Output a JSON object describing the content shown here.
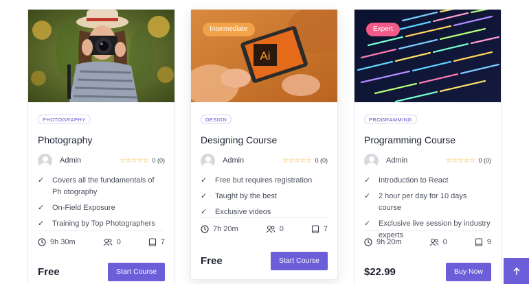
{
  "courses": [
    {
      "level": "",
      "category": "PHOTOGRAPHY",
      "title": "Photography",
      "author": "Admin",
      "rating_text": "0 (0)",
      "features": [
        "Covers all the fundamentals of Ph otography",
        "On-Field Exposure",
        "Training by Top Photographers"
      ],
      "duration": "9h 30m",
      "students": "0",
      "lessons": "7",
      "price": "Free",
      "button": "Start Course"
    },
    {
      "level": "Intermediate",
      "category": "DESIGN",
      "title": "Designing Course",
      "author": "Admin",
      "rating_text": "0 (0)",
      "features": [
        "Free but requires registration",
        "Taught by the best",
        "Exclusive videos"
      ],
      "duration": "7h 20m",
      "students": "0",
      "lessons": "7",
      "price": "Free",
      "button": "Start Course",
      "thumb_logo": "Ai"
    },
    {
      "level": "Expert",
      "category": "PROGRAMMING",
      "title": "Programming Course",
      "author": "Admin",
      "rating_text": "0 (0)",
      "features": [
        "Introduction to React",
        "2 hour per day for 10 days course",
        "Exclusive live session by industry experts"
      ],
      "duration": "9h 20m",
      "students": "0",
      "lessons": "9",
      "price": "$22.99",
      "button": "Buy Now"
    }
  ],
  "stars": "☆☆☆☆☆",
  "tick": "✓",
  "icons": {
    "clock": "clock-icon",
    "students": "users-icon",
    "lessons": "book-icon",
    "scroll_top": "arrow-up-icon"
  },
  "colors": {
    "accent": "#6b5ed8",
    "intermediate_badge": "#f2a349",
    "expert_badge": "#f25b8a",
    "stars": "#f5a623"
  }
}
